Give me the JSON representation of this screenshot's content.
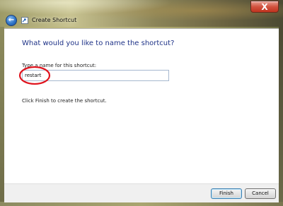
{
  "window": {
    "title": "Create Shortcut",
    "close_glyph": "X"
  },
  "nav": {
    "back_icon": "back-arrow-icon",
    "back_glyph": "←",
    "title_icon": "shortcut-icon"
  },
  "content": {
    "heading": "What would you like to name the shortcut?",
    "field_label": "Type a name for this shortcut:",
    "name_value": "restart",
    "hint": "Click Finish to create the shortcut."
  },
  "footer": {
    "finish_label": "Finish",
    "cancel_label": "Cancel"
  },
  "colors": {
    "heading": "#1e3287",
    "annotation": "#e0141e",
    "close_button": "#c0341f"
  }
}
